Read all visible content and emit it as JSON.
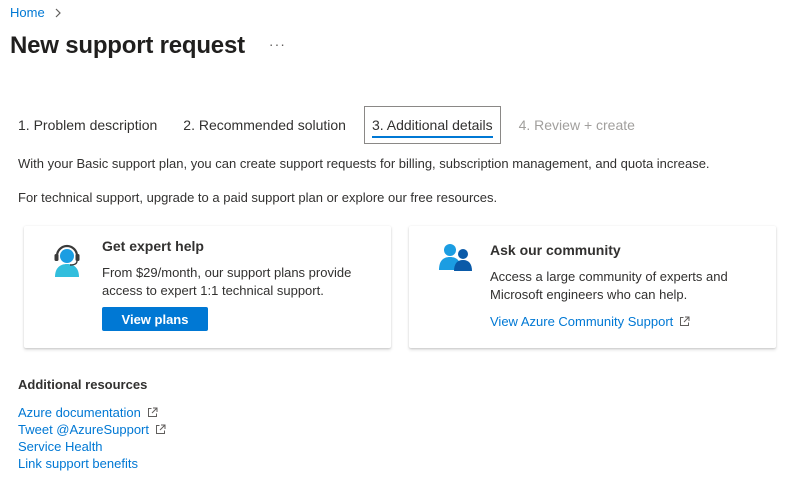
{
  "breadcrumb": {
    "home": "Home"
  },
  "page": {
    "title": "New support request",
    "more": "···"
  },
  "tabs": [
    {
      "label": "1. Problem description"
    },
    {
      "label": "2. Recommended solution"
    },
    {
      "label": "3. Additional details"
    },
    {
      "label": "4. Review + create"
    }
  ],
  "info": {
    "line1": "With your Basic support plan, you can create support requests for billing, subscription management, and quota increase.",
    "line2": "For technical support, upgrade to a paid support plan or explore our free resources."
  },
  "cards": {
    "expert": {
      "title": "Get expert help",
      "description": "From $29/month, our support plans provide access to expert 1:1 technical support.",
      "button": "View plans",
      "icon": "headset-agent-icon"
    },
    "community": {
      "title": "Ask our community",
      "description": "Access a large community of experts and Microsoft engineers who can help.",
      "link": "View Azure Community Support",
      "icon": "people-community-icon"
    }
  },
  "resources": {
    "title": "Additional resources",
    "items": [
      {
        "label": "Azure documentation",
        "external": true
      },
      {
        "label": "Tweet @AzureSupport",
        "external": true
      },
      {
        "label": "Service Health",
        "external": false
      },
      {
        "label": "Link support benefits",
        "external": false
      }
    ]
  },
  "colors": {
    "accent": "#0078d4",
    "text": "#323130",
    "disabled": "#a19f9d"
  }
}
